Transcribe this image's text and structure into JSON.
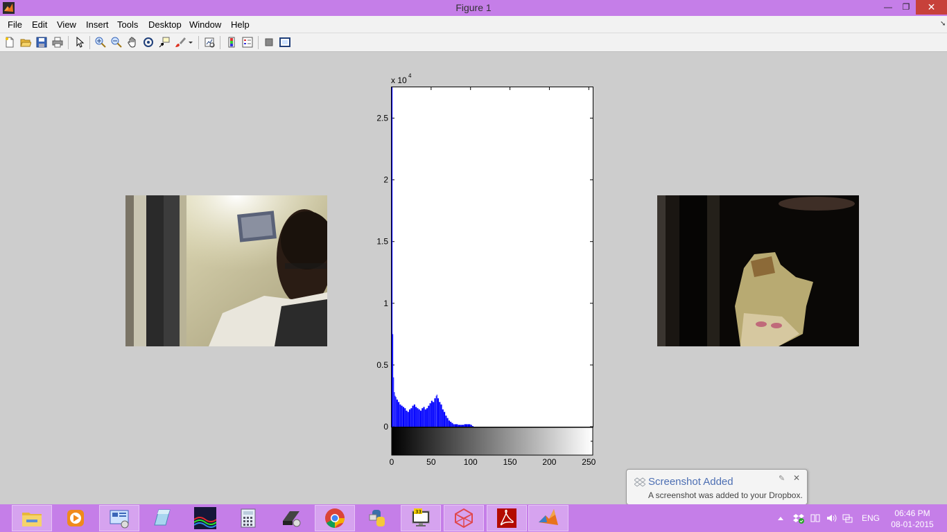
{
  "window": {
    "title": "Figure 1",
    "controls": {
      "minimize": "—",
      "maximize": "❐",
      "close": "✕"
    }
  },
  "menubar": {
    "items": [
      "File",
      "Edit",
      "View",
      "Insert",
      "Tools",
      "Desktop",
      "Window",
      "Help"
    ]
  },
  "toolbar": {
    "buttons": [
      "new-figure-icon",
      "open-file-icon",
      "save-icon",
      "print-icon",
      "edit-plot-arrow-icon",
      "zoom-in-icon",
      "zoom-out-icon",
      "pan-hand-icon",
      "rotate-3d-icon",
      "data-cursor-icon",
      "brush-icon",
      "link-plot-icon",
      "insert-colorbar-icon",
      "insert-legend-icon",
      "hide-plot-tools-icon",
      "show-plot-tools-icon"
    ]
  },
  "histogram": {
    "exponent_label": "x 10",
    "exponent_power": "4",
    "y_ticks": [
      "2.5",
      "2",
      "1.5",
      "1",
      "0.5",
      "0"
    ],
    "x_ticks": [
      "0",
      "50",
      "100",
      "150",
      "200",
      "250"
    ],
    "bar_color": "#0000ff"
  },
  "chart_data": {
    "type": "bar",
    "title": "",
    "xlabel": "",
    "ylabel": "",
    "xlim": [
      0,
      255
    ],
    "ylim": [
      0,
      27500
    ],
    "y_scale_multiplier": 10000,
    "colorbar": "grayscale 0-255",
    "series": [
      {
        "x": [
          0,
          1,
          2,
          3,
          4,
          5,
          6,
          8,
          10,
          12,
          14,
          16,
          18,
          20,
          22,
          24,
          26,
          28,
          30,
          32,
          34,
          36,
          38,
          40,
          42,
          44,
          46,
          48,
          50,
          52,
          54,
          56,
          57,
          58,
          60,
          62,
          64,
          66,
          68,
          70,
          72,
          74,
          76,
          78,
          80,
          84,
          88,
          92,
          96,
          100,
          102
        ],
        "y": [
          27500,
          7500,
          4000,
          2800,
          2500,
          2400,
          2200,
          2000,
          1800,
          1700,
          1600,
          1500,
          1300,
          1200,
          1400,
          1500,
          1700,
          1800,
          1600,
          1500,
          1400,
          1300,
          1500,
          1600,
          1400,
          1500,
          1700,
          1900,
          2100,
          2000,
          2300,
          2500,
          2600,
          2300,
          2000,
          1800,
          1400,
          1200,
          900,
          700,
          500,
          400,
          300,
          200,
          200,
          150,
          150,
          200,
          200,
          150,
          50
        ]
      }
    ]
  },
  "images": {
    "left": "webcam-frame-input",
    "right": "processed-frame-output"
  },
  "taskbar": {
    "apps": [
      "file-explorer-icon",
      "media-player-icon",
      "control-panel-icon",
      "notepad-icon",
      "equalizer-app-icon",
      "calculator-icon",
      "disk-tool-icon",
      "chrome-icon",
      "python-icon",
      "terminal-app-icon",
      "app-3d-icon",
      "acrobat-icon",
      "matlab-icon"
    ],
    "tray": {
      "language": "ENG",
      "time": "06:46 PM",
      "date": "08-01-2015"
    }
  },
  "toast": {
    "title": "Screenshot Added",
    "message": "A screenshot was added to your Dropbox."
  }
}
